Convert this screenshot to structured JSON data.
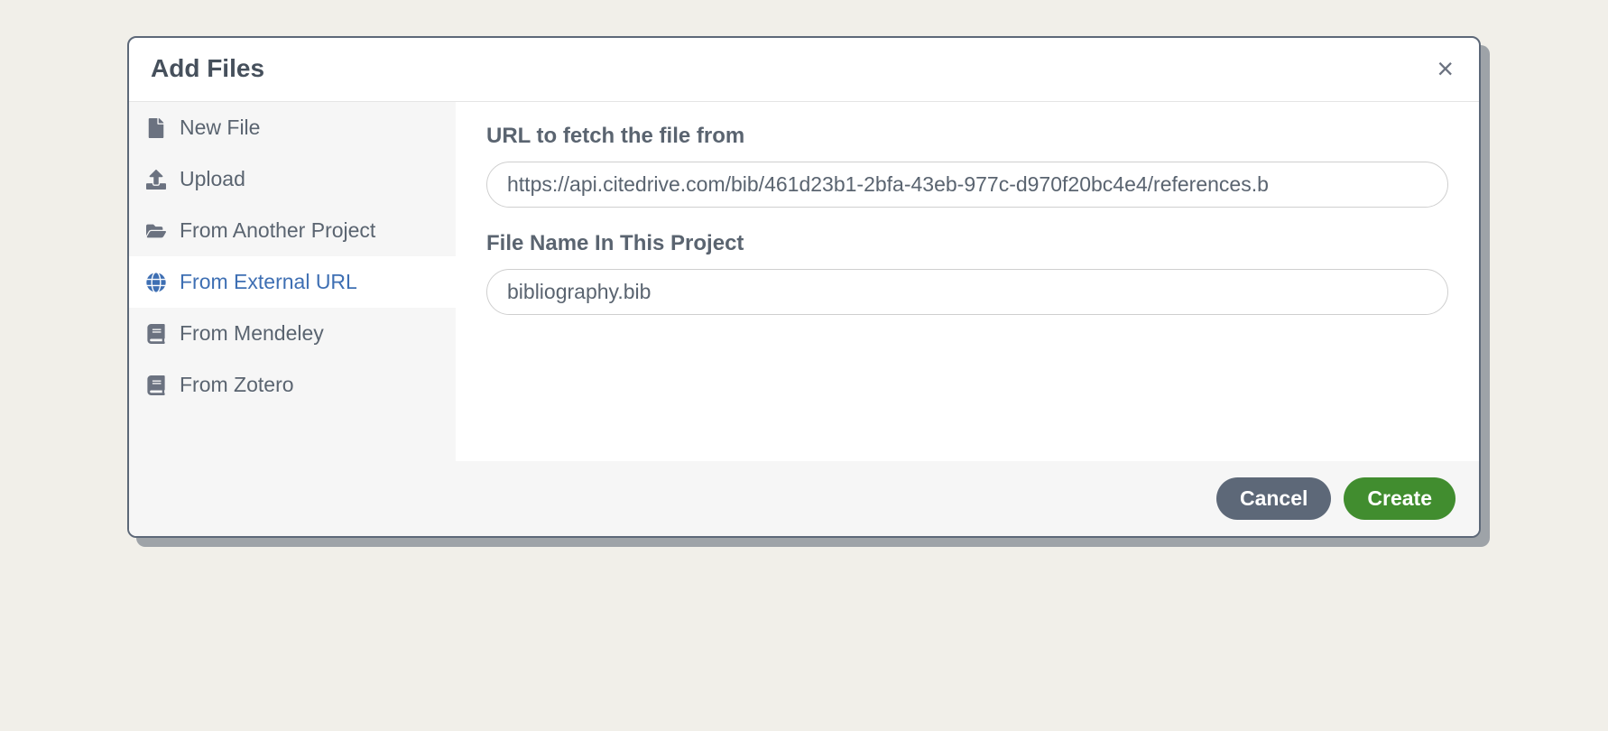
{
  "modal": {
    "title": "Add Files",
    "sidebar": {
      "items": [
        {
          "label": "New File"
        },
        {
          "label": "Upload"
        },
        {
          "label": "From Another Project"
        },
        {
          "label": "From External URL"
        },
        {
          "label": "From Mendeley"
        },
        {
          "label": "From Zotero"
        }
      ]
    },
    "form": {
      "url_label": "URL to fetch the file from",
      "url_value": "https://api.citedrive.com/bib/461d23b1-2bfa-43eb-977c-d970f20bc4e4/references.b",
      "filename_label": "File Name In This Project",
      "filename_value": "bibliography.bib"
    },
    "footer": {
      "cancel_label": "Cancel",
      "create_label": "Create"
    }
  }
}
